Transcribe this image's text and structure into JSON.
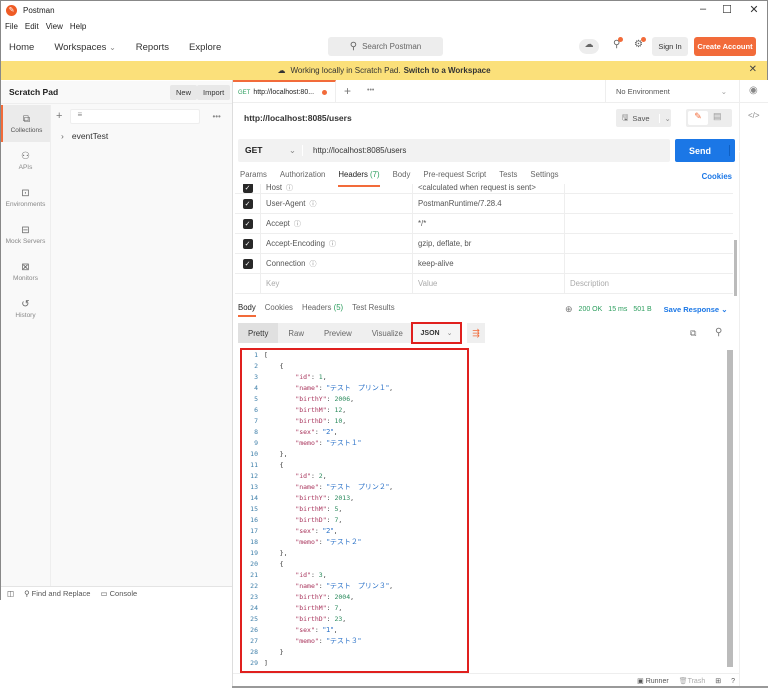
{
  "window": {
    "title": "Postman",
    "minimize": "–",
    "maximize": "☐",
    "close": "✕"
  },
  "menu": [
    "File",
    "Edit",
    "View",
    "Help"
  ],
  "nav": {
    "items": [
      "Home",
      "Workspaces",
      "Reports",
      "Explore"
    ],
    "workspaces_chevron": "⌄",
    "search_placeholder": "Search Postman",
    "sign_in": "Sign In",
    "create_account": "Create Account"
  },
  "banner": {
    "text": "Working locally in Scratch Pad.",
    "link": "Switch to a Workspace"
  },
  "sidebar": {
    "title": "Scratch Pad",
    "new_label": "New",
    "import_label": "Import",
    "rail": [
      {
        "label": "Collections",
        "icon": "collections-icon",
        "glyph": "⧉"
      },
      {
        "label": "APIs",
        "icon": "apis-icon",
        "glyph": "⚇"
      },
      {
        "label": "Environments",
        "icon": "environments-icon",
        "glyph": "⊡"
      },
      {
        "label": "Mock Servers",
        "icon": "mock-servers-icon",
        "glyph": "⊟"
      },
      {
        "label": "Monitors",
        "icon": "monitors-icon",
        "glyph": "⊠"
      },
      {
        "label": "History",
        "icon": "history-icon",
        "glyph": "↺"
      }
    ],
    "collections": [
      "eventTest"
    ],
    "footer": {
      "find_replace": "Find and Replace",
      "console": "Console"
    }
  },
  "request_tab": {
    "method": "GET",
    "title": "http://localhost:80..."
  },
  "environment": "No Environment",
  "request": {
    "name": "http://localhost:8085/users",
    "save_label": "Save",
    "method": "GET",
    "url": "http://localhost:8085/users",
    "send_label": "Send",
    "tabs": [
      {
        "label": "Params"
      },
      {
        "label": "Authorization"
      },
      {
        "label": "Headers",
        "count": "(7)"
      },
      {
        "label": "Body"
      },
      {
        "label": "Pre-request Script"
      },
      {
        "label": "Tests"
      },
      {
        "label": "Settings"
      }
    ],
    "cookies_label": "Cookies",
    "headers": [
      {
        "key": "Host",
        "value": "<calculated when request is sent>"
      },
      {
        "key": "User-Agent",
        "value": "PostmanRuntime/7.28.4"
      },
      {
        "key": "Accept",
        "value": "*/*"
      },
      {
        "key": "Accept-Encoding",
        "value": "gzip, deflate, br"
      },
      {
        "key": "Connection",
        "value": "keep-alive"
      }
    ],
    "header_placeholders": {
      "key": "Key",
      "value": "Value",
      "description": "Description"
    }
  },
  "response": {
    "tabs": [
      {
        "label": "Body"
      },
      {
        "label": "Cookies"
      },
      {
        "label": "Headers",
        "count": "(5)"
      },
      {
        "label": "Test Results"
      }
    ],
    "status": "200 OK",
    "time": "15 ms",
    "size": "501 B",
    "save_response": "Save Response",
    "views": [
      "Pretty",
      "Raw",
      "Preview",
      "Visualize"
    ],
    "format": "JSON",
    "body_lines": [
      [
        {
          "t": "p",
          "v": "["
        }
      ],
      [
        {
          "t": "p",
          "v": "    {"
        }
      ],
      [
        {
          "t": "p",
          "v": "        "
        },
        {
          "t": "k",
          "v": "\"id\""
        },
        {
          "t": "p",
          "v": ": "
        },
        {
          "t": "n",
          "v": "1"
        },
        {
          "t": "p",
          "v": ","
        }
      ],
      [
        {
          "t": "p",
          "v": "        "
        },
        {
          "t": "k",
          "v": "\"name\""
        },
        {
          "t": "p",
          "v": ": "
        },
        {
          "t": "s",
          "v": "\"テスト　プリン１\""
        },
        {
          "t": "p",
          "v": ","
        }
      ],
      [
        {
          "t": "p",
          "v": "        "
        },
        {
          "t": "k",
          "v": "\"birthY\""
        },
        {
          "t": "p",
          "v": ": "
        },
        {
          "t": "n",
          "v": "2006"
        },
        {
          "t": "p",
          "v": ","
        }
      ],
      [
        {
          "t": "p",
          "v": "        "
        },
        {
          "t": "k",
          "v": "\"birthM\""
        },
        {
          "t": "p",
          "v": ": "
        },
        {
          "t": "n",
          "v": "12"
        },
        {
          "t": "p",
          "v": ","
        }
      ],
      [
        {
          "t": "p",
          "v": "        "
        },
        {
          "t": "k",
          "v": "\"birthD\""
        },
        {
          "t": "p",
          "v": ": "
        },
        {
          "t": "n",
          "v": "10"
        },
        {
          "t": "p",
          "v": ","
        }
      ],
      [
        {
          "t": "p",
          "v": "        "
        },
        {
          "t": "k",
          "v": "\"sex\""
        },
        {
          "t": "p",
          "v": ": "
        },
        {
          "t": "s",
          "v": "\"2\""
        },
        {
          "t": "p",
          "v": ","
        }
      ],
      [
        {
          "t": "p",
          "v": "        "
        },
        {
          "t": "k",
          "v": "\"memo\""
        },
        {
          "t": "p",
          "v": ": "
        },
        {
          "t": "s",
          "v": "\"テスト１\""
        }
      ],
      [
        {
          "t": "p",
          "v": "    },"
        }
      ],
      [
        {
          "t": "p",
          "v": "    {"
        }
      ],
      [
        {
          "t": "p",
          "v": "        "
        },
        {
          "t": "k",
          "v": "\"id\""
        },
        {
          "t": "p",
          "v": ": "
        },
        {
          "t": "n",
          "v": "2"
        },
        {
          "t": "p",
          "v": ","
        }
      ],
      [
        {
          "t": "p",
          "v": "        "
        },
        {
          "t": "k",
          "v": "\"name\""
        },
        {
          "t": "p",
          "v": ": "
        },
        {
          "t": "s",
          "v": "\"テスト　プリン２\""
        },
        {
          "t": "p",
          "v": ","
        }
      ],
      [
        {
          "t": "p",
          "v": "        "
        },
        {
          "t": "k",
          "v": "\"birthY\""
        },
        {
          "t": "p",
          "v": ": "
        },
        {
          "t": "n",
          "v": "2013"
        },
        {
          "t": "p",
          "v": ","
        }
      ],
      [
        {
          "t": "p",
          "v": "        "
        },
        {
          "t": "k",
          "v": "\"birthM\""
        },
        {
          "t": "p",
          "v": ": "
        },
        {
          "t": "n",
          "v": "5"
        },
        {
          "t": "p",
          "v": ","
        }
      ],
      [
        {
          "t": "p",
          "v": "        "
        },
        {
          "t": "k",
          "v": "\"birthD\""
        },
        {
          "t": "p",
          "v": ": "
        },
        {
          "t": "n",
          "v": "7"
        },
        {
          "t": "p",
          "v": ","
        }
      ],
      [
        {
          "t": "p",
          "v": "        "
        },
        {
          "t": "k",
          "v": "\"sex\""
        },
        {
          "t": "p",
          "v": ": "
        },
        {
          "t": "s",
          "v": "\"2\""
        },
        {
          "t": "p",
          "v": ","
        }
      ],
      [
        {
          "t": "p",
          "v": "        "
        },
        {
          "t": "k",
          "v": "\"memo\""
        },
        {
          "t": "p",
          "v": ": "
        },
        {
          "t": "s",
          "v": "\"テスト２\""
        }
      ],
      [
        {
          "t": "p",
          "v": "    },"
        }
      ],
      [
        {
          "t": "p",
          "v": "    {"
        }
      ],
      [
        {
          "t": "p",
          "v": "        "
        },
        {
          "t": "k",
          "v": "\"id\""
        },
        {
          "t": "p",
          "v": ": "
        },
        {
          "t": "n",
          "v": "3"
        },
        {
          "t": "p",
          "v": ","
        }
      ],
      [
        {
          "t": "p",
          "v": "        "
        },
        {
          "t": "k",
          "v": "\"name\""
        },
        {
          "t": "p",
          "v": ": "
        },
        {
          "t": "s",
          "v": "\"テスト　プリン３\""
        },
        {
          "t": "p",
          "v": ","
        }
      ],
      [
        {
          "t": "p",
          "v": "        "
        },
        {
          "t": "k",
          "v": "\"birthY\""
        },
        {
          "t": "p",
          "v": ": "
        },
        {
          "t": "n",
          "v": "2004"
        },
        {
          "t": "p",
          "v": ","
        }
      ],
      [
        {
          "t": "p",
          "v": "        "
        },
        {
          "t": "k",
          "v": "\"birthM\""
        },
        {
          "t": "p",
          "v": ": "
        },
        {
          "t": "n",
          "v": "7"
        },
        {
          "t": "p",
          "v": ","
        }
      ],
      [
        {
          "t": "p",
          "v": "        "
        },
        {
          "t": "k",
          "v": "\"birthD\""
        },
        {
          "t": "p",
          "v": ": "
        },
        {
          "t": "n",
          "v": "23"
        },
        {
          "t": "p",
          "v": ","
        }
      ],
      [
        {
          "t": "p",
          "v": "        "
        },
        {
          "t": "k",
          "v": "\"sex\""
        },
        {
          "t": "p",
          "v": ": "
        },
        {
          "t": "s",
          "v": "\"1\""
        },
        {
          "t": "p",
          "v": ","
        }
      ],
      [
        {
          "t": "p",
          "v": "        "
        },
        {
          "t": "k",
          "v": "\"memo\""
        },
        {
          "t": "p",
          "v": ": "
        },
        {
          "t": "s",
          "v": "\"テスト３\""
        }
      ],
      [
        {
          "t": "p",
          "v": "    }"
        }
      ],
      [
        {
          "t": "p",
          "v": "]"
        }
      ]
    ]
  },
  "footer": {
    "runner": "Runner",
    "trash": "Trash"
  },
  "colors": {
    "accent": "#f26b3a",
    "send": "#1b77e6",
    "highlight_box": "#e0201e",
    "banner": "#fbe07a",
    "status_ok": "#2a9d5c"
  }
}
